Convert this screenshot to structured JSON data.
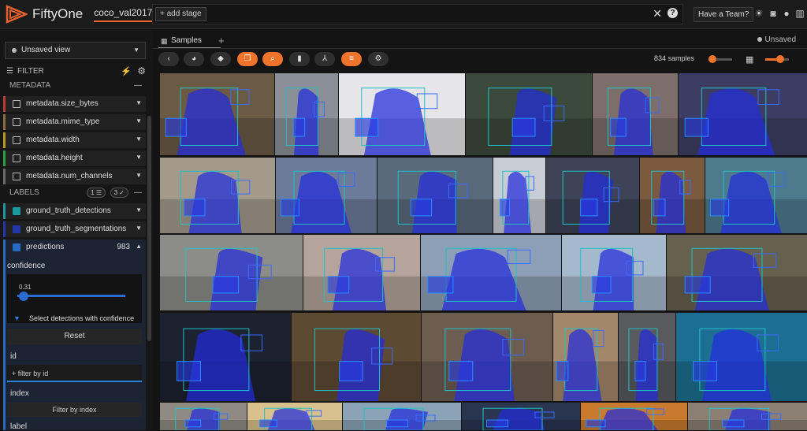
{
  "app": {
    "name": "FiftyOne",
    "dataset": "coco_val2017"
  },
  "stagebar": {
    "add_label": "+ add stage",
    "close_glyph": "✕",
    "help_glyph": "?"
  },
  "header": {
    "team_button": "Have a Team?",
    "icons": [
      "sun-icon",
      "discord-icon",
      "github-icon",
      "docs-icon"
    ]
  },
  "sidebar": {
    "view_selector": "Unsaved view",
    "filter_label": "FILTER",
    "metadata_section": "METADATA",
    "metadata_fields": [
      {
        "name": "metadata.size_bytes",
        "color": "#c0392b"
      },
      {
        "name": "metadata.mime_type",
        "color": "#8e6a3f"
      },
      {
        "name": "metadata.width",
        "color": "#b89a1b"
      },
      {
        "name": "metadata.height",
        "color": "#27a243"
      },
      {
        "name": "metadata.num_channels",
        "color": "#6b6b6b"
      }
    ],
    "labels_section": "LABELS",
    "labels_pills": [
      "1",
      "3"
    ],
    "label_fields": [
      {
        "name": "ground_truth_detections",
        "color": "#1a9aa0",
        "checked": true
      },
      {
        "name": "ground_truth_segmentations",
        "color": "#2238a8",
        "checked": true
      },
      {
        "name": "predictions",
        "color": "#2a69c2",
        "checked": true,
        "count": "983"
      }
    ],
    "predictions": {
      "confidence_label": "confidence",
      "slider_value": "0.31",
      "select_text": "Select detections with confidence",
      "reset_label": "Reset",
      "id_label": "id",
      "id_placeholder": "+ filter by id",
      "index_label": "index",
      "filter_index_label": "Filter by index",
      "label_label": "label"
    }
  },
  "tabs": {
    "samples": "Samples",
    "new_tab": "+",
    "unsaved": "Unsaved"
  },
  "toolbar": {
    "sample_count": "834 samples"
  }
}
